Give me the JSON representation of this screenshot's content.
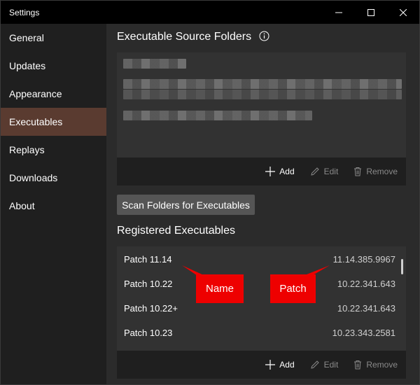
{
  "window": {
    "title": "Settings"
  },
  "sidebar": {
    "items": [
      {
        "label": "General"
      },
      {
        "label": "Updates"
      },
      {
        "label": "Appearance"
      },
      {
        "label": "Executables",
        "active": true
      },
      {
        "label": "Replays"
      },
      {
        "label": "Downloads"
      },
      {
        "label": "About"
      }
    ]
  },
  "source_folders": {
    "title": "Executable Source Folders",
    "info_icon": "info-icon",
    "footer": {
      "add": "Add",
      "edit": "Edit",
      "remove": "Remove"
    }
  },
  "scan_button": "Scan Folders for Executables",
  "registered": {
    "title": "Registered Executables",
    "rows": [
      {
        "name": "Patch 11.14",
        "patch": "11.14.385.9967"
      },
      {
        "name": "Patch 10.22",
        "patch": "10.22.341.643"
      },
      {
        "name": "Patch 10.22+",
        "patch": "10.22.341.643"
      },
      {
        "name": "Patch 10.23",
        "patch": "10.23.343.2581"
      }
    ],
    "footer": {
      "add": "Add",
      "edit": "Edit",
      "remove": "Remove"
    }
  },
  "annotations": {
    "name_label": "Name",
    "patch_label": "Patch",
    "color": "#ee0000"
  },
  "colors": {
    "accent_active": "#5a3b30",
    "sidebar_bg": "#1f1f1f",
    "content_bg": "#2b2b2b"
  }
}
